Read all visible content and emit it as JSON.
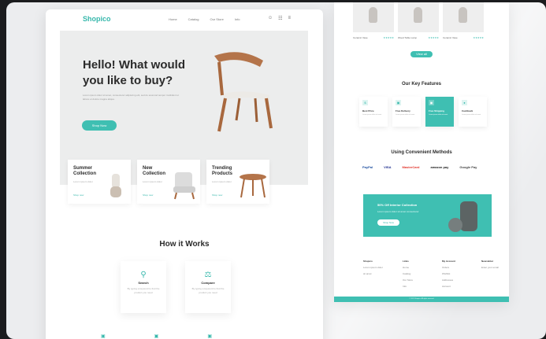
{
  "left_page": {
    "logo": "Shopico",
    "nav": [
      "Home",
      "Catalog",
      "Our Store",
      "Info"
    ],
    "nav_icons": [
      "user-icon",
      "cart-icon",
      "menu-icon"
    ],
    "hero": {
      "title": "Hello! What would you like to buy?",
      "subtitle": "Lorem ipsum dolor sit amet, consectetur adipiscing elit, sed do eiusmod tempor incididunt ut labore et dolore magna aliqua.",
      "button": "Shop Now"
    },
    "collections": [
      {
        "title": "Summer Collection",
        "desc": "Lorem ipsum dolor",
        "link": "Shop now"
      },
      {
        "title": "New Collection",
        "desc": "Lorem ipsum dolor",
        "link": "Shop now"
      },
      {
        "title": "Trending Products",
        "desc": "Lorem ipsum dolor",
        "link": "Shop now"
      }
    ],
    "how_title": "How it Works",
    "steps": [
      {
        "name": "Search",
        "text": "By typing a keyword to find the product you need"
      },
      {
        "name": "Compare",
        "text": "By typing a keyword to find the product you need"
      }
    ]
  },
  "right_page": {
    "products": [
      {
        "name": "Ceramic Vase",
        "rating": "★★★★★"
      },
      {
        "name": "Wood Table Lamp",
        "rating": "★★★★★"
      },
      {
        "name": "Ceramic Vase",
        "rating": "★★★★★"
      }
    ],
    "view_button": "View all",
    "features_title": "Our Key Features",
    "features": [
      {
        "title": "Best Price",
        "text": "Lorem ipsum dolor sit amet"
      },
      {
        "title": "Free Delivery",
        "text": "Lorem ipsum dolor sit amet"
      },
      {
        "title": "Free Shipping",
        "text": "Lorem ipsum dolor sit amet"
      },
      {
        "title": "Cashback",
        "text": "Lorem ipsum dolor sit amet"
      }
    ],
    "payments_title": "Using Convenient Methods",
    "payments": [
      "PayPal",
      "VISA",
      "MasterCard",
      "amazon pay",
      "Google Pay"
    ],
    "banner": {
      "title": "50% Off Interior Collection",
      "text": "Lorem ipsum dolor sit amet consectetur",
      "button": "Shop Now"
    },
    "footer": [
      {
        "title": "Shopico",
        "items": [
          "Lorem ipsum dolor",
          "sit amet"
        ]
      },
      {
        "title": "Links",
        "items": [
          "Home",
          "Catalog",
          "Our Store",
          "Info"
        ]
      },
      {
        "title": "My Account",
        "items": [
          "Orders",
          "Wishlist",
          "Addresses",
          "Account"
        ]
      },
      {
        "title": "Newsletter",
        "items": [
          "Enter your email"
        ]
      }
    ],
    "copyright": "© 2021 Shopico. All rights reserved"
  }
}
